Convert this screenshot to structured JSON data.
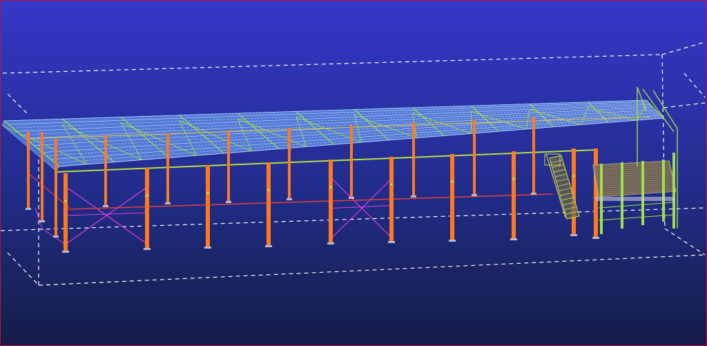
{
  "viewport": {
    "background_top": "#3437c8",
    "background_bottom": "#151c48",
    "border_color": "#c4122f"
  },
  "model": {
    "colors": {
      "roof_panel": "#5f8fe8",
      "roof_edge": "#8fb4ff",
      "column": "#ff7a1e",
      "bracing": "#e040e0",
      "tie_beam": "#d84040",
      "eave_beam": "#b8e040",
      "purlin": "#e8e8f0",
      "truss": "#a0e048",
      "stair": "#d8d840",
      "platform": "#7a6a50",
      "work_area": "#ffffff"
    }
  }
}
